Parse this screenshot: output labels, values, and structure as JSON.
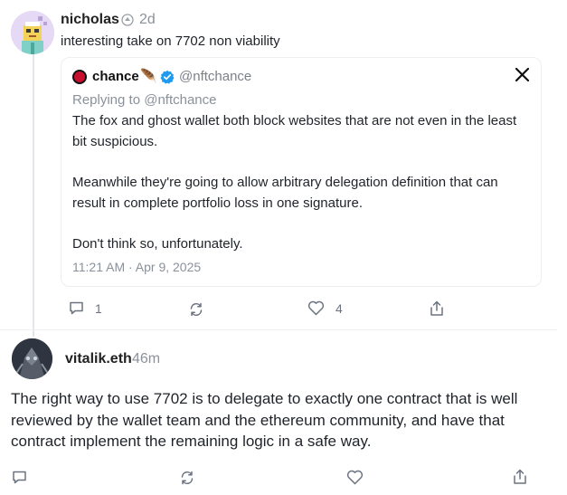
{
  "post1": {
    "username": "nicholas",
    "time": "2d",
    "text": "interesting take on 7702 non viability",
    "quote": {
      "name": "chance",
      "emoji": "🪶",
      "handle": "@nftchance",
      "replying": "Replying to @nftchance",
      "paragraphs": [
        "The fox and ghost wallet both block websites that are not even in the least bit suspicious.",
        "Meanwhile they're going to allow arbitrary delegation definition that can result in complete portfolio loss in one signature.",
        "Don't think so, unfortunately."
      ],
      "timestamp": "11:21 AM · Apr 9, 2025"
    },
    "actions": {
      "reply_count": "1",
      "like_count": "4"
    }
  },
  "post2": {
    "username": "vitalik.eth",
    "time": "46m",
    "text": "The right way to use 7702 is to delegate to exactly one contract that is well reviewed by the wallet team and the ethereum community, and have that contract implement the remaining logic in a safe way."
  },
  "colors": {
    "verified": "#1d9bf0",
    "icon": "#6b7280",
    "muted": "#8b919a"
  }
}
